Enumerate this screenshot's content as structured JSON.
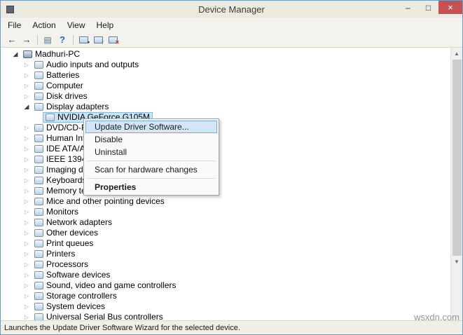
{
  "window": {
    "title": "Device Manager",
    "controls": {
      "minimize": "–",
      "maximize": "□",
      "close": "×"
    }
  },
  "menubar": {
    "items": [
      "File",
      "Action",
      "View",
      "Help"
    ]
  },
  "toolbar": {
    "icons": [
      "back",
      "forward",
      "console-window",
      "help",
      "scan-for-hardware-changes",
      "update-driver-software",
      "uninstall"
    ]
  },
  "tree": {
    "root": {
      "label": "Madhuri-PC",
      "icon": "computer"
    },
    "items": [
      {
        "label": "Audio inputs and outputs",
        "icon": "audio"
      },
      {
        "label": "Batteries",
        "icon": "battery"
      },
      {
        "label": "Computer",
        "icon": "computer"
      },
      {
        "label": "Disk drives",
        "icon": "disk-drive"
      },
      {
        "label": "Display adapters",
        "icon": "display-adapter",
        "expanded": true,
        "children": [
          {
            "label": "NVIDIA GeForce G105M",
            "icon": "display-adapter",
            "selected": true
          }
        ]
      },
      {
        "label": "DVD/CD-ROM drives",
        "icon": "dvd-drive"
      },
      {
        "label": "Human Interface Devices",
        "icon": "hid"
      },
      {
        "label": "IDE ATA/ATAPI controllers",
        "icon": "ide-controller"
      },
      {
        "label": "IEEE 1394 host controllers",
        "icon": "ieee1394"
      },
      {
        "label": "Imaging devices",
        "icon": "imaging-device"
      },
      {
        "label": "Keyboards",
        "icon": "keyboard"
      },
      {
        "label": "Memory technology devices",
        "icon": "memory-device"
      },
      {
        "label": "Mice and other pointing devices",
        "icon": "mouse"
      },
      {
        "label": "Monitors",
        "icon": "monitor"
      },
      {
        "label": "Network adapters",
        "icon": "network-adapter"
      },
      {
        "label": "Other devices",
        "icon": "other-device"
      },
      {
        "label": "Print queues",
        "icon": "print-queue"
      },
      {
        "label": "Printers",
        "icon": "printer"
      },
      {
        "label": "Processors",
        "icon": "processor"
      },
      {
        "label": "Software devices",
        "icon": "software-device"
      },
      {
        "label": "Sound, video and game controllers",
        "icon": "sound-controller"
      },
      {
        "label": "Storage controllers",
        "icon": "storage-controller"
      },
      {
        "label": "System devices",
        "icon": "system-device"
      },
      {
        "label": "Universal Serial Bus controllers",
        "icon": "usb-controller"
      }
    ]
  },
  "context_menu": {
    "items": [
      {
        "label": "Update Driver Software...",
        "highlighted": true
      },
      {
        "label": "Disable"
      },
      {
        "label": "Uninstall"
      },
      {
        "type": "separator"
      },
      {
        "label": "Scan for hardware changes"
      },
      {
        "type": "separator"
      },
      {
        "label": "Properties",
        "bold": true
      }
    ]
  },
  "statusbar": {
    "text": "Launches the Update Driver Software Wizard for the selected device."
  },
  "watermark": "wsxdn.com"
}
